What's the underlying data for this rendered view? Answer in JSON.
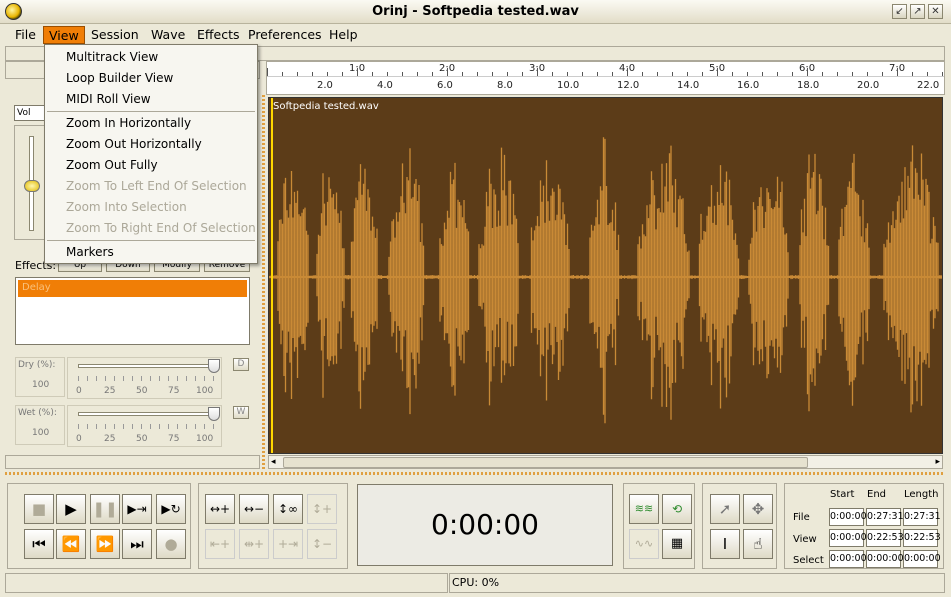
{
  "window": {
    "title": "Orinj - Softpedia tested.wav",
    "buttons": [
      "↙",
      "↗",
      "✕"
    ]
  },
  "menubar": {
    "items": [
      {
        "label": "File",
        "mnemonic": "F",
        "active": false
      },
      {
        "label": "View",
        "mnemonic": "V",
        "active": true
      },
      {
        "label": "Session",
        "mnemonic": "S",
        "active": false
      },
      {
        "label": "Wave",
        "mnemonic": "W",
        "active": false
      },
      {
        "label": "Effects",
        "mnemonic": "E",
        "active": false
      },
      {
        "label": "Preferences",
        "mnemonic": "P",
        "active": false
      },
      {
        "label": "Help",
        "mnemonic": "H",
        "active": false
      }
    ]
  },
  "view_menu": {
    "items": [
      {
        "label": "Multitrack View",
        "enabled": true
      },
      {
        "label": "Loop Builder View",
        "enabled": true
      },
      {
        "label": "MIDI Roll View",
        "enabled": true
      },
      {
        "label": "Zoom In Horizontally",
        "enabled": true
      },
      {
        "label": "Zoom Out Horizontally",
        "enabled": true
      },
      {
        "label": "Zoom Out Fully",
        "enabled": true
      },
      {
        "label": "Zoom To Left End Of Selection",
        "enabled": false
      },
      {
        "label": "Zoom Into Selection",
        "enabled": false
      },
      {
        "label": "Zoom To Right End Of Selection",
        "enabled": false
      },
      {
        "label": "Markers",
        "enabled": true
      }
    ]
  },
  "ruler": {
    "top_labels": [
      "1:0",
      "2:0",
      "3:0",
      "4:0",
      "5:0",
      "6:0",
      "7:0"
    ],
    "bottom_labels": [
      "2.0",
      "4.0",
      "6.0",
      "8.0",
      "10.0",
      "12.0",
      "14.0",
      "16.0",
      "18.0",
      "20.0",
      "22.0"
    ]
  },
  "wave": {
    "label": "Softpedia tested.wav",
    "fill_color": "#c98a36",
    "bg_color": "#5c3c18"
  },
  "left_panel": {
    "vol_select": "Vol",
    "effects_label": "Effects:",
    "effects_buttons": [
      "Up",
      "Down",
      "Modify",
      "Remove"
    ],
    "effects_list": [
      "Delay"
    ],
    "dry": {
      "label": "Dry (%):",
      "value": "100",
      "toggle": "D",
      "value_fraction": 1.0,
      "scale": [
        "0",
        "25",
        "50",
        "75",
        "100"
      ]
    },
    "wet": {
      "label": "Wet (%):",
      "value": "100",
      "toggle": "W",
      "value_fraction": 1.0,
      "scale": [
        "0",
        "25",
        "50",
        "75",
        "100"
      ]
    }
  },
  "transport": {
    "time": "0:00:00"
  },
  "times": {
    "headers": [
      "Start",
      "End",
      "Length"
    ],
    "rows": [
      {
        "label": "File",
        "values": [
          "0:00:00",
          "0:27:31",
          "0:27:31"
        ]
      },
      {
        "label": "View",
        "values": [
          "0:00:00",
          "0:22:53",
          "0:22:53"
        ]
      },
      {
        "label": "Select",
        "values": [
          "0:00:00",
          "0:00:00",
          "0:00:00"
        ]
      }
    ]
  },
  "status": {
    "cpu": "CPU: 0%"
  }
}
